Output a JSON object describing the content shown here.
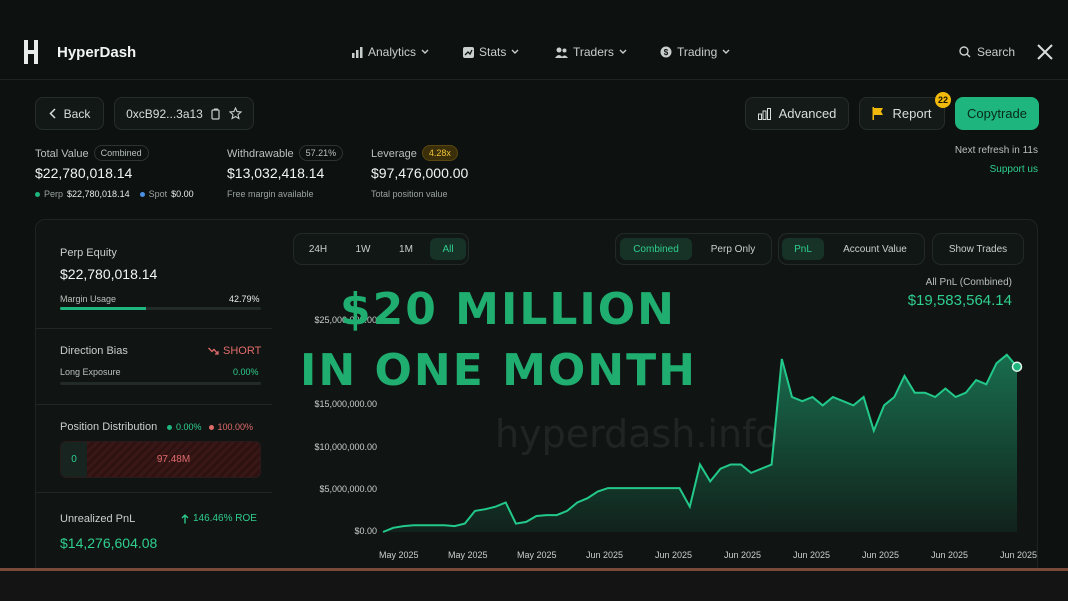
{
  "brand": {
    "name": "HyperDash"
  },
  "nav": {
    "items": [
      {
        "label": "Analytics",
        "icon": "bar-chart-icon"
      },
      {
        "label": "Stats",
        "icon": "stats-icon"
      },
      {
        "label": "Traders",
        "icon": "users-icon"
      },
      {
        "label": "Trading",
        "icon": "coin-icon"
      }
    ],
    "search_label": "Search",
    "social_icon": "x-logo-icon"
  },
  "toolbar": {
    "back_label": "Back",
    "address": "0xcB92...3a13",
    "advanced_label": "Advanced",
    "report_label": "Report",
    "report_badge": "22",
    "copytrade_label": "Copytrade"
  },
  "stats": {
    "total_value": {
      "label": "Total Value",
      "pill": "Combined",
      "value": "$22,780,018.14",
      "perp_label": "Perp",
      "perp_value": "$22,780,018.14",
      "spot_label": "Spot",
      "spot_value": "$0.00"
    },
    "withdrawable": {
      "label": "Withdrawable",
      "pill": "57.21%",
      "value": "$13,032,418.14",
      "sub": "Free margin available"
    },
    "leverage": {
      "label": "Leverage",
      "pill": "4.28x",
      "value": "$97,476,000.00",
      "sub": "Total position value"
    },
    "refresh": "Next refresh in 11s",
    "support": "Support us"
  },
  "left": {
    "perp_equity_label": "Perp Equity",
    "perp_equity_value": "$22,780,018.14",
    "margin_usage_label": "Margin Usage",
    "margin_usage_value": "42.79%",
    "margin_usage_fraction": 0.4279,
    "direction_bias_label": "Direction Bias",
    "direction_bias_value": "SHORT",
    "long_exposure_label": "Long Exposure",
    "long_exposure_value": "0.00%",
    "position_dist_label": "Position Distribution",
    "long_pct": "0.00%",
    "short_pct": "100.00%",
    "long_amount": "0",
    "short_amount": "97.48M",
    "unrealized_label": "Unrealized PnL",
    "unrealized_roe": "146.46% ROE",
    "unrealized_value": "$14,276,604.08"
  },
  "chart_controls": {
    "ranges": [
      "24H",
      "1W",
      "1M",
      "All"
    ],
    "active_range": "All",
    "scope": [
      "Combined",
      "Perp Only"
    ],
    "metric": [
      "PnL",
      "Account Value"
    ],
    "show_trades": "Show Trades"
  },
  "overlay": {
    "line1": "$20 MILLION",
    "line2": "IN ONE MONTH"
  },
  "watermark": "hyperdash.info",
  "colors": {
    "accent": "#1fb57e",
    "short": "#e06b6b",
    "background": "#0d1110",
    "badge": "#f0b90b"
  },
  "chart_data": {
    "type": "area",
    "title": "All PnL (Combined)",
    "current_value_label": "$19,583,564.14",
    "ylim": [
      0,
      25000000
    ],
    "y_ticks": [
      "$0.00",
      "$5,000,000.00",
      "$10,000,000.00",
      "$15,000,000.00",
      "$25,000,000.00"
    ],
    "y_tick_values": [
      0,
      5000000,
      10000000,
      15000000,
      25000000
    ],
    "x_ticks": [
      "May 2025",
      "May 2025",
      "May 2025",
      "Jun 2025",
      "Jun 2025",
      "Jun 2025",
      "Jun 2025",
      "Jun 2025",
      "Jun 2025",
      "Jun 2025"
    ],
    "series": [
      {
        "values": [
          0,
          500000,
          700000,
          800000,
          800000,
          800000,
          800000,
          700000,
          1000000,
          2500000,
          2700000,
          3000000,
          3500000,
          1000000,
          1200000,
          1900000,
          2000000,
          2000000,
          2500000,
          3500000,
          4000000,
          4800000,
          5200000,
          5200000,
          5200000,
          5200000,
          5200000,
          5200000,
          5200000,
          5200000,
          3000000,
          8000000,
          6000000,
          7500000,
          8000000,
          8000000,
          7000000,
          7500000,
          8000000,
          20500000,
          16000000,
          15500000,
          16000000,
          15000000,
          16000000,
          15500000,
          15000000,
          16000000,
          12000000,
          15000000,
          16000000,
          18500000,
          16500000,
          16500000,
          16000000,
          17000000,
          16000000,
          16500000,
          18000000,
          17500000,
          20000000,
          21000000,
          19583564
        ]
      }
    ]
  }
}
